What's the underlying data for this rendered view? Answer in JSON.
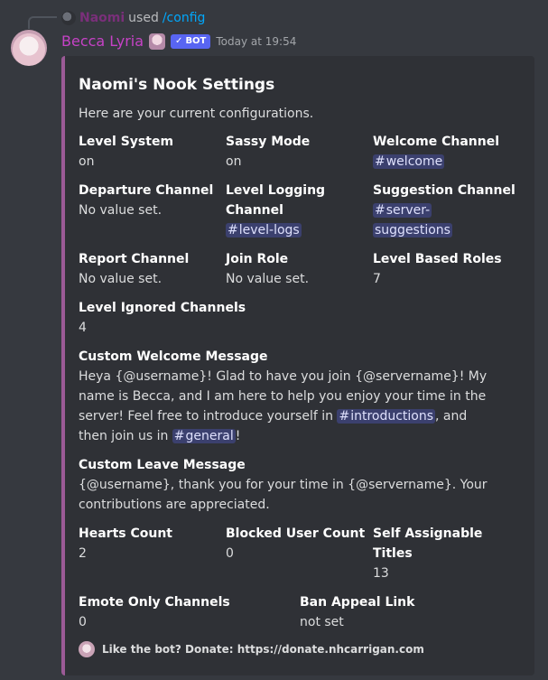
{
  "reply": {
    "user": "Naomi",
    "used": "used",
    "command": "/config"
  },
  "message": {
    "author": "Becca Lyria",
    "bot_tag": "BOT",
    "timestamp": "Today at 19:54"
  },
  "embed": {
    "accent_color": "#9b5a96",
    "title": "Naomi's Nook Settings",
    "description": "Here are your current configurations.",
    "fields": {
      "level_system": {
        "name": "Level System",
        "value": "on"
      },
      "sassy_mode": {
        "name": "Sassy Mode",
        "value": "on"
      },
      "welcome_channel": {
        "name": "Welcome Channel",
        "value": "welcome"
      },
      "departure_channel": {
        "name": "Departure Channel",
        "value": "No value set."
      },
      "level_logging_channel": {
        "name_line1": "Level Logging",
        "name_line2": "Channel",
        "value": "level-logs"
      },
      "suggestion_channel": {
        "name": "Suggestion Channel",
        "value_line1": "server-",
        "value_line2": "suggestions"
      },
      "report_channel": {
        "name": "Report Channel",
        "value": "No value set."
      },
      "join_role": {
        "name": "Join Role",
        "value": "No value set."
      },
      "level_based_roles": {
        "name": "Level Based Roles",
        "value": "7"
      },
      "level_ignored_channels": {
        "name": "Level Ignored Channels",
        "value": "4"
      },
      "custom_welcome_message": {
        "name": "Custom Welcome Message",
        "line1": "Heya {@username}! Glad to have you join {@servername}! My",
        "line2": "name is Becca, and I am here to help you enjoy your time in the",
        "line3_pre": "server! Feel free to introduce yourself in ",
        "channel1": "introductions",
        "line3_post": ", and",
        "line4_pre": "then join us in ",
        "channel2": "general",
        "line4_post": "!"
      },
      "custom_leave_message": {
        "name": "Custom Leave Message",
        "line1": "{@username}, thank you for your time in {@servername}. Your",
        "line2": "contributions are appreciated."
      },
      "hearts_count": {
        "name": "Hearts Count",
        "value": "2"
      },
      "blocked_user_count": {
        "name": "Blocked User Count",
        "value": "0"
      },
      "self_assignable_titles": {
        "name_line1": "Self Assignable",
        "name_line2": "Titles",
        "value": "13"
      },
      "emote_only_channels": {
        "name": "Emote Only Channels",
        "value": "0"
      },
      "ban_appeal_link": {
        "name": "Ban Appeal Link",
        "value": "not set"
      }
    },
    "footer": "Like the bot? Donate: https://donate.nhcarrigan.com"
  },
  "icons": {
    "check": "✓",
    "hash": "#"
  }
}
